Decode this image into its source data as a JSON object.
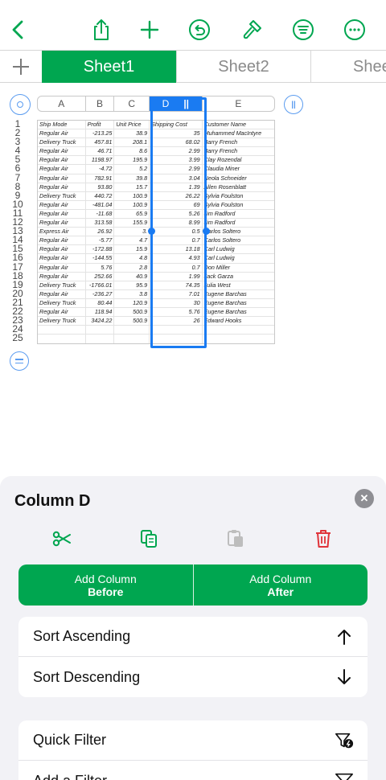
{
  "toolbar": {
    "icons": [
      "back-chevron-icon",
      "share-icon",
      "add-icon",
      "undo-icon",
      "format-brush-icon",
      "organize-icon",
      "more-icon"
    ],
    "accent": "#00a650"
  },
  "tabs": {
    "items": [
      {
        "label": "Sheet1",
        "active": true
      },
      {
        "label": "Sheet2",
        "active": false
      },
      {
        "label": "Shee",
        "active": false
      }
    ]
  },
  "sheet": {
    "columns": [
      "A",
      "B",
      "C",
      "D",
      "E"
    ],
    "selected_column": "D",
    "selection_color": "#1a7bf2",
    "row_numbers": [
      "1",
      "2",
      "3",
      "4",
      "5",
      "6",
      "7",
      "8",
      "9",
      "10",
      "11",
      "12",
      "13",
      "14",
      "15",
      "16",
      "17",
      "18",
      "19",
      "20",
      "21",
      "22",
      "23",
      "24",
      "25"
    ],
    "header": [
      "Ship Mode",
      "Profit",
      "Unit Price",
      "Shipping Cost",
      "Customer Name"
    ],
    "rows": [
      [
        "Regular Air",
        "-213.25",
        "38.9",
        "35",
        "Muhammed MacIntyre"
      ],
      [
        "Delivery Truck",
        "457.81",
        "208.1",
        "68.02",
        "Barry French"
      ],
      [
        "Regular Air",
        "46.71",
        "8.6",
        "2.99",
        "Barry French"
      ],
      [
        "Regular Air",
        "1198.97",
        "195.9",
        "3.99",
        "Clay Rozendal"
      ],
      [
        "Regular Air",
        "-4.72",
        "5.2",
        "2.99",
        "Claudia Miner"
      ],
      [
        "Regular Air",
        "782.91",
        "39.8",
        "3.04",
        "Neola Schneider"
      ],
      [
        "Regular Air",
        "93.80",
        "15.7",
        "1.39",
        "Allen Rosenblatt"
      ],
      [
        "Delivery Truck",
        "440.72",
        "100.9",
        "26.22",
        "Sylvia Foulston"
      ],
      [
        "Regular Air",
        "-481.04",
        "100.9",
        "69",
        "Sylvia Foulston"
      ],
      [
        "Regular Air",
        "-11.68",
        "65.9",
        "5.26",
        "Jim Radford"
      ],
      [
        "Regular Air",
        "313.58",
        "155.9",
        "8.99",
        "Jim Radford"
      ],
      [
        "Express Air",
        "26.92",
        "3.",
        "0.5",
        "Carlos Soltero"
      ],
      [
        "Regular Air",
        "-5.77",
        "4.7",
        "0.7",
        "Carlos Soltero"
      ],
      [
        "Regular Air",
        "-172.88",
        "15.9",
        "13.18",
        "Carl Ludwig"
      ],
      [
        "Regular Air",
        "-144.55",
        "4.8",
        "4.93",
        "Carl Ludwig"
      ],
      [
        "Regular Air",
        "5.76",
        "2.8",
        "0.7",
        "Don Miller"
      ],
      [
        "Regular Air",
        "252.66",
        "40.9",
        "1.99",
        "Jack Garza"
      ],
      [
        "Delivery Truck",
        "-1766.01",
        "95.9",
        "74.35",
        "Julia West"
      ],
      [
        "Regular Air",
        "-236.27",
        "3.8",
        "7.01",
        "Eugene Barchas"
      ],
      [
        "Delivery Truck",
        "80.44",
        "120.9",
        "30",
        "Eugene Barchas"
      ],
      [
        "Regular Air",
        "118.94",
        "500.9",
        "5.76",
        "Eugene Barchas"
      ],
      [
        "Delivery Truck",
        "3424.22",
        "500.9",
        "26",
        "Edward Hooks"
      ],
      [
        "",
        "",
        "",
        "",
        ""
      ],
      [
        "",
        "",
        "",
        "",
        ""
      ]
    ]
  },
  "panel": {
    "title": "Column D",
    "actions": [
      "scissors-icon",
      "copy-icon",
      "paste-icon",
      "trash-icon"
    ],
    "add_before": {
      "line1": "Add Column",
      "line2": "Before"
    },
    "add_after": {
      "line1": "Add Column",
      "line2": "After"
    },
    "sort": [
      "Sort Ascending",
      "Sort Descending"
    ],
    "filters": [
      "Quick Filter",
      "Add a Filter"
    ]
  }
}
